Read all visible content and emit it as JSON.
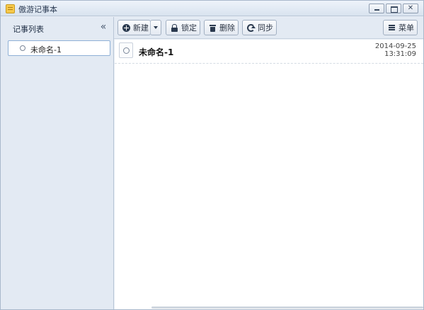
{
  "window": {
    "title": "傲游记事本",
    "icon": "notepad-icon",
    "controls": {
      "minimize_icon": "minimize-icon",
      "maximize_icon": "restore-icon",
      "close_glyph": "✕"
    }
  },
  "sidebar": {
    "title": "记事列表",
    "collapse_glyph": "«",
    "items": [
      {
        "label": "未命名-1"
      }
    ]
  },
  "toolbar": {
    "new_label": "新建",
    "lock_label": "锁定",
    "delete_label": "删除",
    "sync_label": "同步",
    "menu_label": "菜单"
  },
  "note": {
    "title": "未命名-1",
    "date": "2014-09-25",
    "time": "13:31:09",
    "body": ""
  }
}
